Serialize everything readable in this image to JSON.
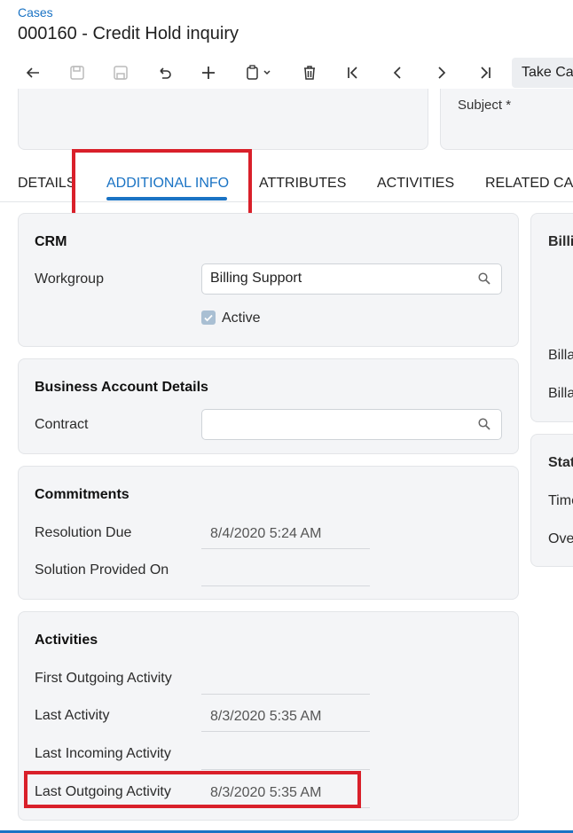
{
  "header": {
    "breadcrumb": "Cases",
    "title": "000160 - Credit Hold inquiry"
  },
  "toolbar": {
    "buttons": [
      "back-icon",
      "save-icon",
      "save-close-icon",
      "undo-icon",
      "add-icon",
      "copy-paste-icon",
      "delete-icon",
      "first-record-icon",
      "previous-icon",
      "next-icon",
      "last-record-icon"
    ],
    "take_case_label": "Take Ca"
  },
  "top_right": {
    "subject_label": "Subject *"
  },
  "tabs": [
    {
      "label": "DETAILS"
    },
    {
      "label": "ADDITIONAL INFO",
      "active": true
    },
    {
      "label": "ATTRIBUTES"
    },
    {
      "label": "ACTIVITIES"
    },
    {
      "label": "RELATED CA"
    }
  ],
  "crm": {
    "title": "CRM",
    "workgroup_label": "Workgroup",
    "workgroup_value": "Billing Support",
    "active_label": "Active",
    "active_checked": true
  },
  "business": {
    "title": "Business Account Details",
    "contract_label": "Contract",
    "contract_value": ""
  },
  "commitments": {
    "title": "Commitments",
    "resolution_due_label": "Resolution Due",
    "resolution_due_value": "8/4/2020 5:24 AM",
    "solution_provided_label": "Solution Provided On",
    "solution_provided_value": ""
  },
  "activities": {
    "title": "Activities",
    "first_outgoing_label": "First Outgoing Activity",
    "first_outgoing_value": "",
    "last_activity_label": "Last Activity",
    "last_activity_value": "8/3/2020 5:35 AM",
    "last_incoming_label": "Last Incoming Activity",
    "last_incoming_value": "",
    "last_outgoing_label": "Last Outgoing Activity",
    "last_outgoing_value": "8/3/2020 5:35 AM"
  },
  "right_panel": {
    "billing_title": "Billi",
    "billable_1": "Billa",
    "billable_2": "Billa",
    "status_title": "Stat",
    "time_label": "Time",
    "over_label": "Ove"
  },
  "colors": {
    "accent": "#1a73c4",
    "highlight": "#d9202a",
    "card_bg": "#f4f5f7"
  }
}
